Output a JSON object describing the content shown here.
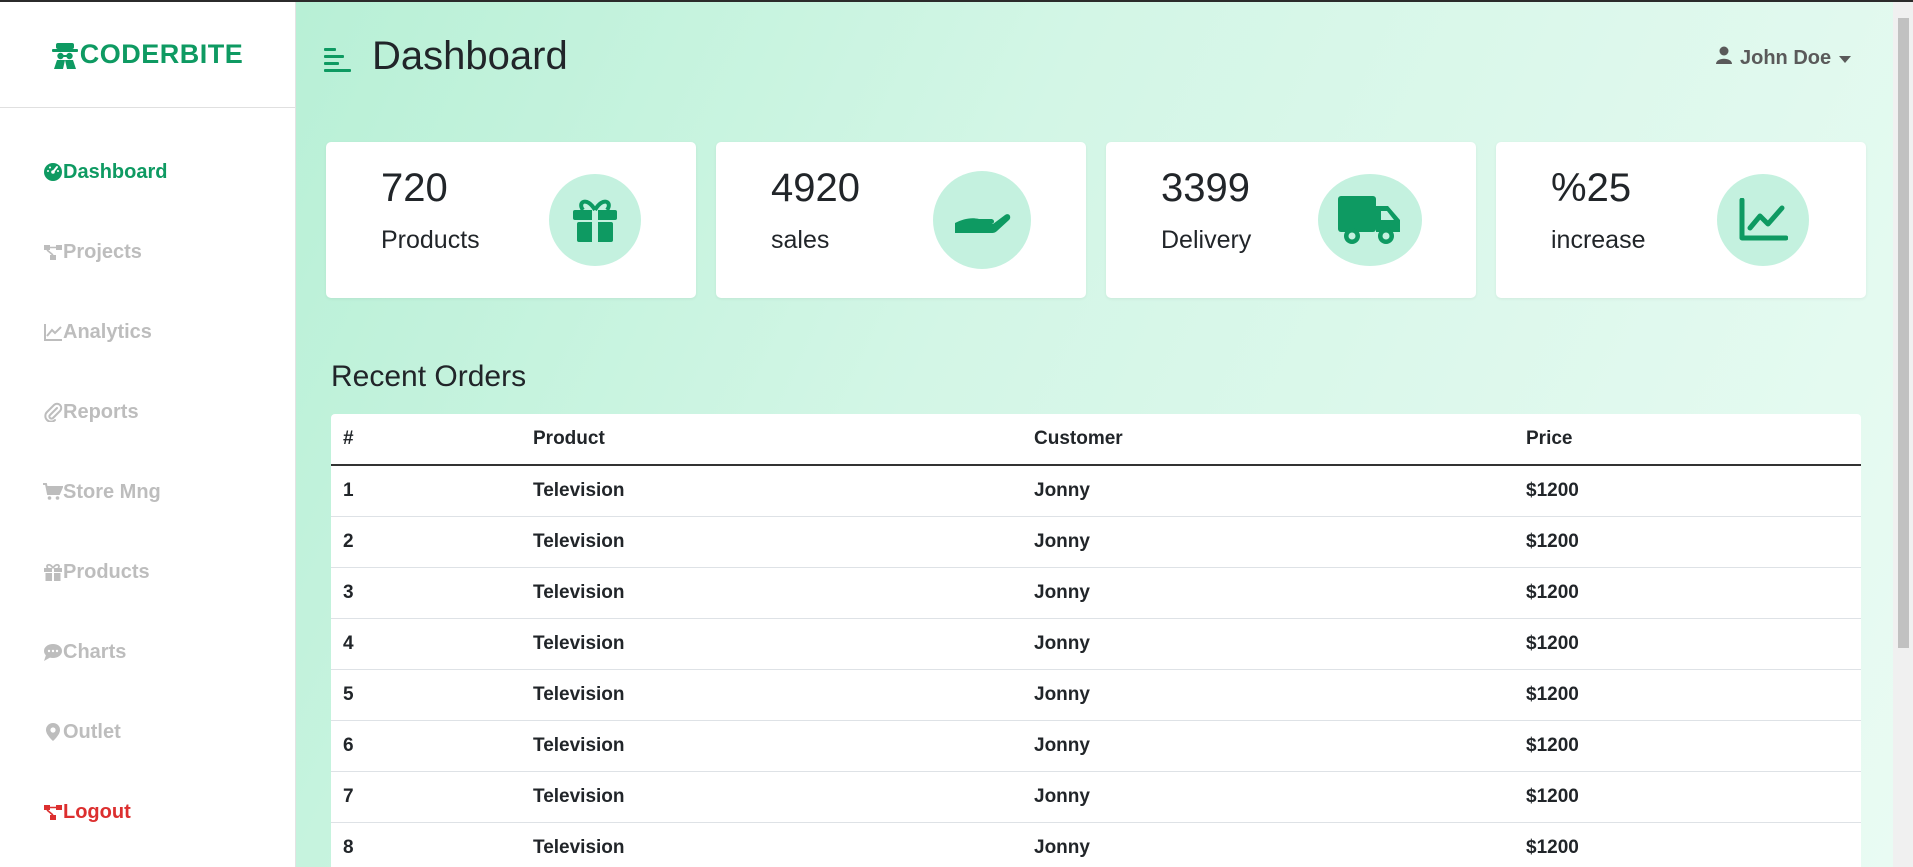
{
  "brand": {
    "name": "CODERBITE"
  },
  "sidebar": {
    "items": [
      {
        "label": "Dashboard",
        "icon": "dashboard-gauge-icon",
        "state": "active"
      },
      {
        "label": "Projects",
        "icon": "projects-diagram-icon"
      },
      {
        "label": "Analytics",
        "icon": "analytics-chart-icon"
      },
      {
        "label": "Reports",
        "icon": "paperclip-icon"
      },
      {
        "label": "Store Mng",
        "icon": "shopping-cart-icon"
      },
      {
        "label": "Products",
        "icon": "gift-icon"
      },
      {
        "label": "Charts",
        "icon": "chat-bubble-icon"
      },
      {
        "label": "Outlet",
        "icon": "map-pin-icon"
      },
      {
        "label": "Logout",
        "icon": "logout-diagram-icon"
      }
    ]
  },
  "header": {
    "title": "Dashboard",
    "user_name": "John Doe"
  },
  "cards": [
    {
      "value": "720",
      "label": "Products",
      "icon": "gift-icon"
    },
    {
      "value": "4920",
      "label": "sales",
      "icon": "hand-holding-icon"
    },
    {
      "value": "3399",
      "label": "Delivery",
      "icon": "truck-icon"
    },
    {
      "value": "%25",
      "label": "increase",
      "icon": "line-chart-icon"
    }
  ],
  "orders": {
    "title": "Recent Orders",
    "columns": [
      "#",
      "Product",
      "Customer",
      "Price"
    ],
    "rows": [
      [
        "1",
        "Television",
        "Jonny",
        "$1200"
      ],
      [
        "2",
        "Television",
        "Jonny",
        "$1200"
      ],
      [
        "3",
        "Television",
        "Jonny",
        "$1200"
      ],
      [
        "4",
        "Television",
        "Jonny",
        "$1200"
      ],
      [
        "5",
        "Television",
        "Jonny",
        "$1200"
      ],
      [
        "6",
        "Television",
        "Jonny",
        "$1200"
      ],
      [
        "7",
        "Television",
        "Jonny",
        "$1200"
      ],
      [
        "8",
        "Television",
        "Jonny",
        "$1200"
      ]
    ]
  },
  "colors": {
    "accent": "#0e9a62",
    "inactive_nav": "#bdbdbd",
    "logout": "#dc2f2f",
    "icon_circle": "#c4f1df",
    "main_bg_start": "#b8f0d6",
    "main_bg_end": "#e9fbf3"
  }
}
